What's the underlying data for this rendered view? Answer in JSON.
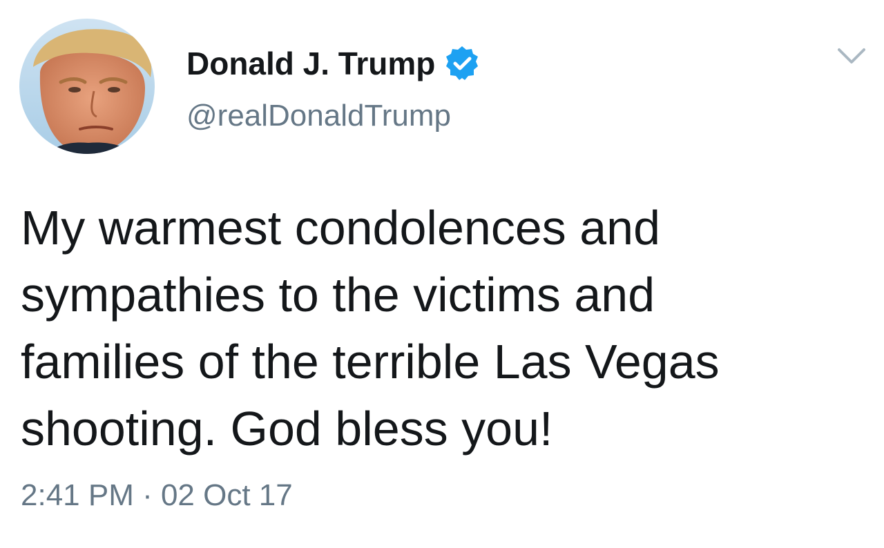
{
  "tweet": {
    "author": {
      "name": "Donald J. Trump",
      "handle": "@realDonaldTrump",
      "verified": true
    },
    "text_lines": [
      "My warmest condolences and",
      "sympathies to the victims and",
      "families of the terrible Las Vegas",
      "shooting. God bless you!"
    ],
    "timestamp": "2:41 PM · 02 Oct 17"
  },
  "icons": {
    "verified": "verified-badge-icon",
    "menu": "chevron-down-icon",
    "avatar": "profile-photo"
  },
  "colors": {
    "text_primary": "#14171a",
    "text_secondary": "#657786",
    "verified_blue": "#1da1f2",
    "chevron": "#aab8c2"
  }
}
